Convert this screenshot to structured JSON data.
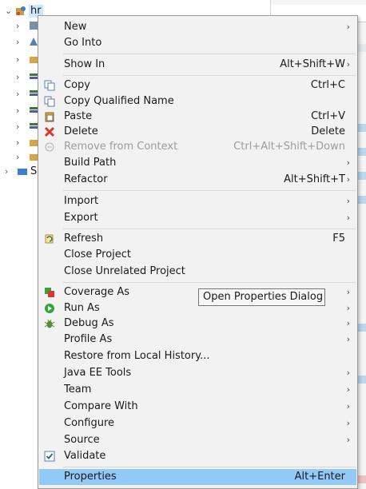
{
  "tree": {
    "root_label": "hr",
    "second_label": "S"
  },
  "menu": {
    "items": [
      {
        "label": "New",
        "shortcut": "",
        "submenu": true,
        "icon": ""
      },
      {
        "label": "Go Into",
        "shortcut": "",
        "submenu": false,
        "icon": ""
      },
      {
        "label": "Show In",
        "shortcut": "Alt+Shift+W",
        "submenu": true,
        "icon": ""
      },
      {
        "label": "Copy",
        "shortcut": "Ctrl+C",
        "submenu": false,
        "icon": "copy-icon"
      },
      {
        "label": "Copy Qualified Name",
        "shortcut": "",
        "submenu": false,
        "icon": "copy-qualified-icon"
      },
      {
        "label": "Paste",
        "shortcut": "Ctrl+V",
        "submenu": false,
        "icon": "paste-icon"
      },
      {
        "label": "Delete",
        "shortcut": "Delete",
        "submenu": false,
        "icon": "delete-icon"
      },
      {
        "label": "Remove from Context",
        "shortcut": "Ctrl+Alt+Shift+Down",
        "submenu": false,
        "icon": "remove-context-icon",
        "disabled": true
      },
      {
        "label": "Build Path",
        "shortcut": "",
        "submenu": true,
        "icon": ""
      },
      {
        "label": "Refactor",
        "shortcut": "Alt+Shift+T",
        "submenu": true,
        "icon": ""
      },
      {
        "label": "Import",
        "shortcut": "",
        "submenu": true,
        "icon": ""
      },
      {
        "label": "Export",
        "shortcut": "",
        "submenu": true,
        "icon": ""
      },
      {
        "label": "Refresh",
        "shortcut": "F5",
        "submenu": false,
        "icon": "refresh-icon"
      },
      {
        "label": "Close Project",
        "shortcut": "",
        "submenu": false,
        "icon": ""
      },
      {
        "label": "Close Unrelated Project",
        "shortcut": "",
        "submenu": false,
        "icon": ""
      },
      {
        "label": "Coverage As",
        "shortcut": "",
        "submenu": true,
        "icon": "coverage-icon"
      },
      {
        "label": "Run As",
        "shortcut": "",
        "submenu": true,
        "icon": "run-icon"
      },
      {
        "label": "Debug As",
        "shortcut": "",
        "submenu": true,
        "icon": "debug-icon"
      },
      {
        "label": "Profile As",
        "shortcut": "",
        "submenu": true,
        "icon": ""
      },
      {
        "label": "Restore from Local History...",
        "shortcut": "",
        "submenu": false,
        "icon": ""
      },
      {
        "label": "Java EE Tools",
        "shortcut": "",
        "submenu": true,
        "icon": ""
      },
      {
        "label": "Team",
        "shortcut": "",
        "submenu": true,
        "icon": ""
      },
      {
        "label": "Compare With",
        "shortcut": "",
        "submenu": true,
        "icon": ""
      },
      {
        "label": "Configure",
        "shortcut": "",
        "submenu": true,
        "icon": ""
      },
      {
        "label": "Source",
        "shortcut": "",
        "submenu": true,
        "icon": ""
      },
      {
        "label": "Validate",
        "shortcut": "",
        "submenu": false,
        "icon": "validate-check-icon"
      },
      {
        "label": "Properties",
        "shortcut": "Alt+Enter",
        "submenu": false,
        "icon": "",
        "selected": true
      }
    ]
  },
  "tooltip": {
    "text": "Open Properties Dialog"
  },
  "colors": {
    "menu_bg": "#f2f2f2",
    "selected_bg": "#91c9f7",
    "disabled_text": "#9c9c9c",
    "delete_red": "#d9372b",
    "run_green": "#3aa23a"
  }
}
